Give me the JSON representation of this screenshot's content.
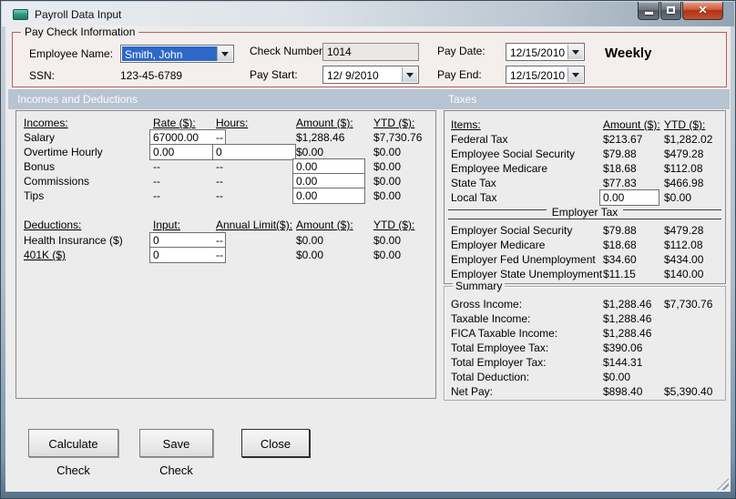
{
  "window": {
    "title": "Payroll Data Input",
    "frequency": "Weekly"
  },
  "colors": {
    "group_border": "#bf5b5b",
    "section_band": "#b7c4d1",
    "selection_blue": "#2d68c8",
    "close_red": "#b33115"
  },
  "paycheck_info": {
    "group_label": "Pay Check Information",
    "employee_name_label": "Employee Name:",
    "employee_name_value": "Smith, John",
    "ssn_label": "SSN:",
    "ssn_value": "123-45-6789",
    "check_number_label": "Check Number:",
    "check_number_value": "1014",
    "pay_start_label": "Pay Start:",
    "pay_start_value": "12/ 9/2010",
    "pay_date_label": "Pay Date:",
    "pay_date_value": "12/15/2010",
    "pay_end_label": "Pay End:",
    "pay_end_value": "12/15/2010"
  },
  "sections": {
    "incomes_deductions": "Incomes and Deductions",
    "taxes": "Taxes"
  },
  "incomes": {
    "label": "Incomes:",
    "col_rate": "Rate ($):",
    "col_hours": "Hours:",
    "col_amount": "Amount ($):",
    "col_ytd": "YTD ($):",
    "rows": [
      {
        "name": "Salary",
        "rate": "67000.00",
        "hours": "--",
        "amount": "$1,288.46",
        "ytd": "$7,730.76"
      },
      {
        "name": "Overtime Hourly",
        "rate": "0.00",
        "hours": "0",
        "amount": "$0.00",
        "ytd": "$0.00"
      },
      {
        "name": "Bonus",
        "rate": "--",
        "hours": "--",
        "amount": "0.00",
        "ytd": "$0.00"
      },
      {
        "name": "Commissions",
        "rate": "--",
        "hours": "--",
        "amount": "0.00",
        "ytd": "$0.00"
      },
      {
        "name": "Tips",
        "rate": "--",
        "hours": "--",
        "amount": "0.00",
        "ytd": "$0.00"
      }
    ]
  },
  "deductions": {
    "label": "Deductions:",
    "col_input": "Input:",
    "col_limit": "Annual Limit($):",
    "col_amount": "Amount ($):",
    "col_ytd": "YTD ($):",
    "rows": [
      {
        "name": "Health Insurance  ($)",
        "input": "0",
        "limit": "--",
        "amount": "$0.00",
        "ytd": "$0.00"
      },
      {
        "name": "401K  ($)",
        "input": "0",
        "limit": "--",
        "amount": "$0.00",
        "ytd": "$0.00"
      }
    ]
  },
  "taxes": {
    "col_items": "Items:",
    "col_amount": "Amount ($):",
    "col_ytd": "YTD ($):",
    "employee_rows": [
      {
        "name": "Federal Tax",
        "amount": "$213.67",
        "ytd": "$1,282.02"
      },
      {
        "name": "Employee Social Security",
        "amount": "$79.88",
        "ytd": "$479.28"
      },
      {
        "name": "Employee Medicare",
        "amount": "$18.68",
        "ytd": "$112.08"
      },
      {
        "name": "State Tax",
        "amount": "$77.83",
        "ytd": "$466.98"
      },
      {
        "name": "Local Tax",
        "amount": "0.00",
        "ytd": "$0.00"
      }
    ],
    "employer_label": "Employer Tax",
    "employer_rows": [
      {
        "name": "Employer Social Security",
        "amount": "$79.88",
        "ytd": "$479.28"
      },
      {
        "name": "Employer Medicare",
        "amount": "$18.68",
        "ytd": "$112.08"
      },
      {
        "name": "Employer Fed Unemployment",
        "amount": "$34.60",
        "ytd": "$434.00"
      },
      {
        "name": "Employer State Unemployment",
        "amount": "$11.15",
        "ytd": "$140.00"
      }
    ]
  },
  "summary": {
    "label": "Summary",
    "rows": [
      {
        "name": "Gross Income:",
        "amount": "$1,288.46",
        "ytd": "$7,730.76"
      },
      {
        "name": "Taxable Income:",
        "amount": "$1,288.46",
        "ytd": ""
      },
      {
        "name": "FICA Taxable Income:",
        "amount": "$1,288.46",
        "ytd": ""
      },
      {
        "name": "Total Employee Tax:",
        "amount": "$390.06",
        "ytd": ""
      },
      {
        "name": "Total Employer Tax:",
        "amount": "$144.31",
        "ytd": ""
      },
      {
        "name": "Total Deduction:",
        "amount": "$0.00",
        "ytd": ""
      },
      {
        "name": "Net Pay:",
        "amount": "$898.40",
        "ytd": "$5,390.40"
      }
    ]
  },
  "buttons": {
    "calculate": "Calculate Check",
    "save": "Save Check",
    "close": "Close"
  }
}
